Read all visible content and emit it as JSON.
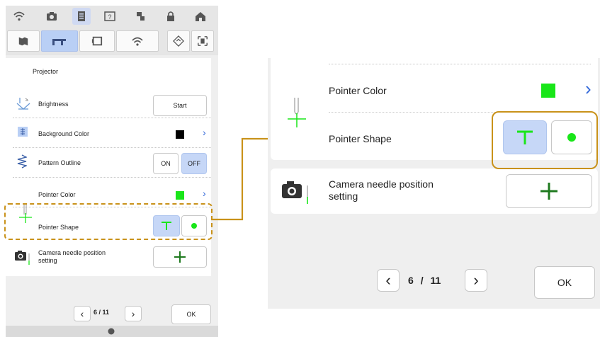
{
  "left_panel": {
    "header": {
      "title": "Projector"
    },
    "rows": {
      "brightness": {
        "label": "Brightness",
        "button": "Start"
      },
      "background_color": {
        "label": "Background Color",
        "swatch": "#000000"
      },
      "pattern_outline": {
        "label": "Pattern Outline",
        "on": "ON",
        "off": "OFF"
      },
      "pointer_color": {
        "label": "Pointer Color",
        "swatch": "#19e619"
      },
      "pointer_shape": {
        "label": "Pointer Shape"
      },
      "camera": {
        "label_line1": "Camera needle position",
        "label_line2": "setting"
      }
    },
    "pager": {
      "text": "6 / 11",
      "ok": "OK"
    }
  },
  "right_panel": {
    "pointer_color": {
      "label": "Pointer Color",
      "swatch": "#19e619"
    },
    "pointer_shape": {
      "label": "Pointer Shape"
    },
    "camera": {
      "label_line1": "Camera needle position",
      "label_line2": "setting"
    },
    "pager": {
      "page": "6",
      "sep": "/",
      "total": "11",
      "ok": "OK"
    }
  },
  "colors": {
    "accent_outline": "#c9921a",
    "selected": "#c6d7f7",
    "pointer": "#19e619",
    "chevron": "#2f66d9"
  },
  "icons": [
    "wifi-icon",
    "camera-icon",
    "document-icon",
    "help-icon",
    "embroidery-icon",
    "lock-icon",
    "house-icon",
    "map-icon",
    "sewing-machine-icon",
    "embroidery-frame-icon",
    "wifi-icon",
    "diamond-icon",
    "frame-icon",
    "brightness-icon",
    "background-icon",
    "pattern-outline-icon",
    "pointer-icon",
    "camera-needle-icon",
    "plus-icon",
    "chevron-left-icon",
    "chevron-right-icon",
    "arrow-icon",
    "home-dot-icon"
  ]
}
